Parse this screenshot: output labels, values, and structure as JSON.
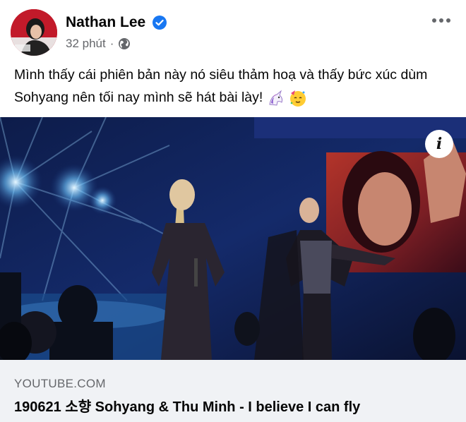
{
  "post": {
    "author": "Nathan Lee",
    "time": "32 phút",
    "separator": "·",
    "text": "Mình thấy cái phiên bản này nó siêu thảm hoạ và thấy bức xúc dùm Sohyang nên tối nay mình sẽ hát bài lày!",
    "emojis": [
      "unicorn-emoji",
      "partying-face-emoji"
    ]
  },
  "link_preview": {
    "domain": "YOUTUBE.COM",
    "title": "190621 소향 Sohyang & Thu Minh - I believe I can fly"
  },
  "icons": {
    "verified": "verified-badge-icon",
    "privacy": "globe-icon",
    "more": "more-options-icon",
    "info": "info-icon"
  },
  "colors": {
    "verified_blue": "#1877f2",
    "secondary_text": "#65676b",
    "link_box_bg": "#f0f2f5"
  }
}
